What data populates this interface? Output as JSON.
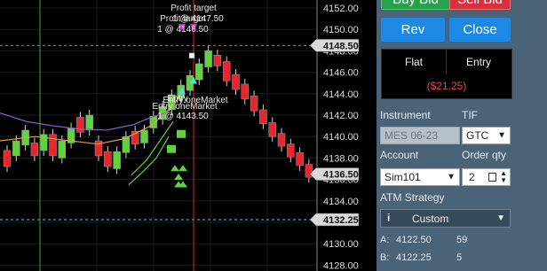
{
  "chart": {
    "price_ticks": [
      "4152.00",
      "4150.00",
      "4148.00",
      "4146.00",
      "4144.00",
      "4142.00",
      "4140.00",
      "4138.00",
      "4136.00",
      "4134.00",
      "4132.00",
      "4130.00",
      "4128.00"
    ],
    "tags": {
      "upper": "4148.50",
      "last": "4136.50",
      "lower": "4132.25"
    },
    "annotations": {
      "profit_target_title": "Profit target",
      "profit_target_overlap": "Profit target",
      "profit_target_price": "1 @ 4147.50",
      "profit_target_price2": "1 @ 4146.50",
      "entry_title": "Entry",
      "entry_overlap": "Entry oneMarket",
      "entry_price": "1 @ 4143.50",
      "entry_overlap2": "Entry oneMarket"
    },
    "colors": {
      "up": "#5fd33a",
      "down": "#e8262d",
      "upper_line": "#e25a8c",
      "lower_line": "#4ec9e8",
      "tag_bg": "#d9d9d9"
    }
  },
  "panel": {
    "buy_label": "Buy Bid",
    "sell_label": "Sell Bid",
    "rev_label": "Rev",
    "close_label": "Close",
    "position": {
      "status": "Flat",
      "entry": "Entry",
      "pnl": "($21.25)"
    },
    "instrument_label": "Instrument",
    "instrument_value": "MES 06-23",
    "tif_label": "TIF",
    "tif_value": "GTC",
    "account_label": "Account",
    "account_value": "Sim101",
    "qty_label": "Order qty",
    "qty_value": "2",
    "atm_label": "ATM Strategy",
    "atm_value": "Custom",
    "ask_label": "A:",
    "ask_price": "4122.50",
    "ask_size": "59",
    "bid_label": "B:",
    "bid_price": "4122.25",
    "bid_size": "5",
    "colors": {
      "buy": "#27a24a",
      "sell": "#d93040",
      "blue": "#1e88e5",
      "pnl": "#e84545"
    }
  }
}
